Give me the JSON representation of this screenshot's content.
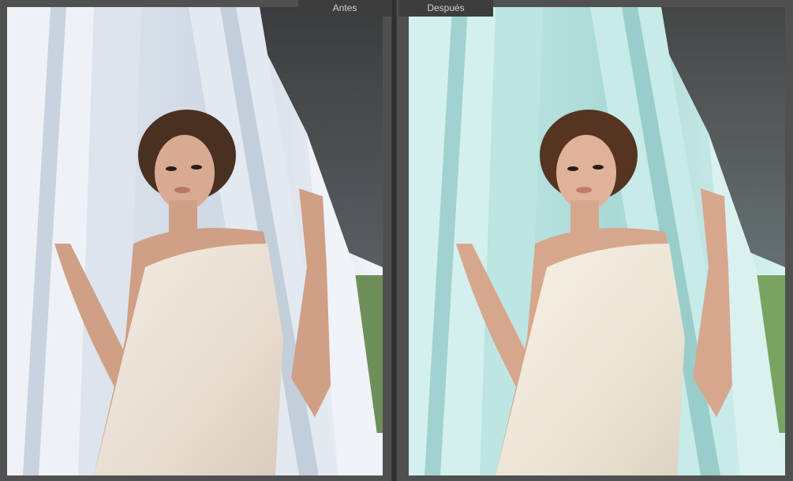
{
  "compare_view": {
    "before_label": "Antes",
    "after_label": "Después"
  },
  "colors": {
    "before_curtain": "#dfe6ef",
    "after_curtain": "#bfe6e4",
    "dress": "#efe6da",
    "frame_bg": "#4b4b4b",
    "label_bg": "#3d3d3d"
  }
}
